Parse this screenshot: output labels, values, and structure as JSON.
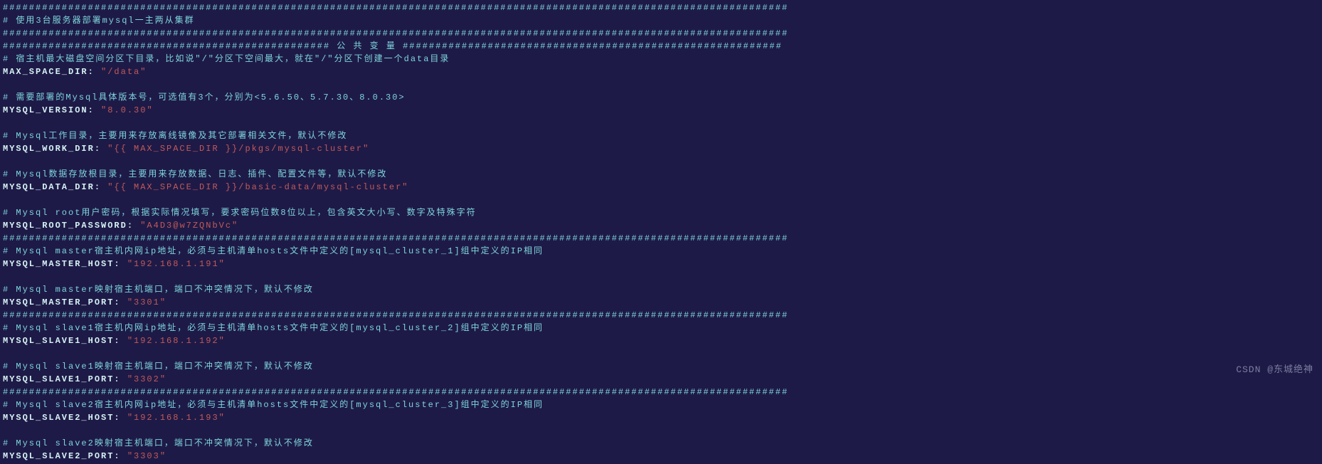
{
  "lines": [
    {
      "segments": [
        {
          "cls": "cyan",
          "t": "########################################################################################################################"
        }
      ]
    },
    {
      "segments": [
        {
          "cls": "cyan",
          "t": "# 使用3台服务器部署mysql一主两从集群"
        }
      ]
    },
    {
      "segments": [
        {
          "cls": "cyan",
          "t": "########################################################################################################################"
        }
      ]
    },
    {
      "segments": [
        {
          "cls": "cyan",
          "t": "################################################## 公 共 变 量 ##########################################################"
        }
      ]
    },
    {
      "segments": [
        {
          "cls": "cyan",
          "t": "# 宿主机最大磁盘空间分区下目录，比如说\"/\"分区下空间最大，就在\"/\"分区下创建一个data目录"
        }
      ]
    },
    {
      "segments": [
        {
          "cls": "key",
          "t": "MAX_SPACE_DIR: "
        },
        {
          "cls": "red",
          "t": "\"/data\""
        }
      ]
    },
    {
      "segments": [
        {
          "cls": "",
          "t": " "
        }
      ]
    },
    {
      "segments": [
        {
          "cls": "cyan",
          "t": "# 需要部署的Mysql具体版本号，可选值有3个，分别为<5.6.50、5.7.30、8.0.30>"
        }
      ]
    },
    {
      "segments": [
        {
          "cls": "key",
          "t": "MYSQL_VERSION: "
        },
        {
          "cls": "red",
          "t": "\"8.0.30\""
        }
      ]
    },
    {
      "segments": [
        {
          "cls": "",
          "t": " "
        }
      ]
    },
    {
      "segments": [
        {
          "cls": "cyan",
          "t": "# Mysql工作目录，主要用来存放离线镜像及其它部署相关文件，默认不修改"
        }
      ]
    },
    {
      "segments": [
        {
          "cls": "key",
          "t": "MYSQL_WORK_DIR: "
        },
        {
          "cls": "red",
          "t": "\"{{ MAX_SPACE_DIR }}/pkgs/mysql-cluster\""
        }
      ]
    },
    {
      "segments": [
        {
          "cls": "",
          "t": " "
        }
      ]
    },
    {
      "segments": [
        {
          "cls": "cyan",
          "t": "# Mysql数据存放根目录，主要用来存放数据、日志、插件、配置文件等，默认不修改"
        }
      ]
    },
    {
      "segments": [
        {
          "cls": "key",
          "t": "MYSQL_DATA_DIR: "
        },
        {
          "cls": "red",
          "t": "\"{{ MAX_SPACE_DIR }}/basic-data/mysql-cluster\""
        }
      ]
    },
    {
      "segments": [
        {
          "cls": "",
          "t": " "
        }
      ]
    },
    {
      "segments": [
        {
          "cls": "cyan",
          "t": "# Mysql root用户密码，根据实际情况填写，要求密码位数8位以上，包含英文大小写、数字及特殊字符"
        }
      ]
    },
    {
      "segments": [
        {
          "cls": "key",
          "t": "MYSQL_ROOT_PASSWORD: "
        },
        {
          "cls": "red",
          "t": "\"A4D3@w7ZQNbVc\""
        }
      ]
    },
    {
      "segments": [
        {
          "cls": "cyan",
          "t": "########################################################################################################################"
        }
      ]
    },
    {
      "segments": [
        {
          "cls": "cyan",
          "t": "# Mysql master宿主机内网ip地址，必须与主机清单hosts文件中定义的[mysql_cluster_1]组中定义的IP相同"
        }
      ]
    },
    {
      "segments": [
        {
          "cls": "key",
          "t": "MYSQL_MASTER_HOST: "
        },
        {
          "cls": "red",
          "t": "\"192.168.1.191\""
        }
      ]
    },
    {
      "segments": [
        {
          "cls": "",
          "t": " "
        }
      ]
    },
    {
      "segments": [
        {
          "cls": "cyan",
          "t": "# Mysql master映射宿主机端口，端口不冲突情况下，默认不修改"
        }
      ]
    },
    {
      "segments": [
        {
          "cls": "key",
          "t": "MYSQL_MASTER_PORT: "
        },
        {
          "cls": "red",
          "t": "\"3301\""
        }
      ]
    },
    {
      "segments": [
        {
          "cls": "cyan",
          "t": "########################################################################################################################"
        }
      ]
    },
    {
      "segments": [
        {
          "cls": "cyan",
          "t": "# Mysql slave1宿主机内网ip地址，必须与主机清单hosts文件中定义的[mysql_cluster_2]组中定义的IP相同"
        }
      ]
    },
    {
      "segments": [
        {
          "cls": "key",
          "t": "MYSQL_SLAVE1_HOST: "
        },
        {
          "cls": "red",
          "t": "\"192.168.1.192\""
        }
      ]
    },
    {
      "segments": [
        {
          "cls": "",
          "t": " "
        }
      ]
    },
    {
      "segments": [
        {
          "cls": "cyan",
          "t": "# Mysql slave1映射宿主机端口，端口不冲突情况下，默认不修改"
        }
      ]
    },
    {
      "segments": [
        {
          "cls": "key",
          "t": "MYSQL_SLAVE1_PORT: "
        },
        {
          "cls": "red",
          "t": "\"3302\""
        }
      ]
    },
    {
      "segments": [
        {
          "cls": "cyan",
          "t": "########################################################################################################################"
        }
      ]
    },
    {
      "segments": [
        {
          "cls": "cyan",
          "t": "# Mysql slave2宿主机内网ip地址，必须与主机清单hosts文件中定义的[mysql_cluster_3]组中定义的IP相同"
        }
      ]
    },
    {
      "segments": [
        {
          "cls": "key",
          "t": "MYSQL_SLAVE2_HOST: "
        },
        {
          "cls": "red",
          "t": "\"192.168.1.193\""
        }
      ]
    },
    {
      "segments": [
        {
          "cls": "",
          "t": " "
        }
      ]
    },
    {
      "segments": [
        {
          "cls": "cyan",
          "t": "# Mysql slave2映射宿主机端口，端口不冲突情况下，默认不修改"
        }
      ]
    },
    {
      "segments": [
        {
          "cls": "key",
          "t": "MYSQL_SLAVE2_PORT: "
        },
        {
          "cls": "red",
          "t": "\"3303\""
        }
      ]
    }
  ],
  "watermark": "CSDN @东城绝神"
}
